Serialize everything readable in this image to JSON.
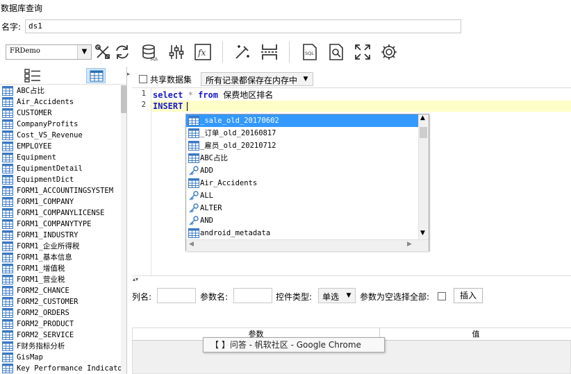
{
  "window": {
    "title": "数据库查询"
  },
  "name_row": {
    "label": "名字:",
    "value": "ds1"
  },
  "toolbar": {
    "datasource": "FRDemo",
    "icons": [
      "tools-icon",
      "refresh-icon",
      "sql-database-icon",
      "sliders-icon",
      "formula-fx-icon",
      "magic-wand-icon",
      "page-break-icon",
      "sql-file-icon",
      "preview-icon",
      "fullscreen-icon",
      "settings-gear-icon"
    ]
  },
  "left_panel": {
    "tabs": [
      "list-view",
      "table-view"
    ],
    "tables": [
      "ABC占比",
      "Air_Accidents",
      "CUSTOMER",
      "CompanyProfits",
      "Cost_VS_Revenue",
      "EMPLOYEE",
      "Equipment",
      "EquipmentDetail",
      "EquipmentDict",
      "FORM1_ACCOUNTINGSYSTEM",
      "FORM1_COMPANY",
      "FORM1_COMPANYLICENSE",
      "FORM1_COMPANYTYPE",
      "FORM1_INDUSTRY",
      "FORM1_企业所得税",
      "FORM1_基本信息",
      "FORM1_增值税",
      "FORM1_营业税",
      "FORM2_CHANCE",
      "FORM2_CUSTOMER",
      "FORM2_ORDERS",
      "FORM2_PRODUCT",
      "FORM2_SERVICE",
      "F财务指标分析",
      "GisMap",
      "Key Performance Indicators"
    ]
  },
  "sql_options": {
    "share_label": "共享数据集",
    "cache_option": "所有记录都保存在内存中"
  },
  "editor": {
    "line_numbers": [
      "1",
      "2"
    ],
    "line1": {
      "kw1": "select",
      "op": "*",
      "kw2": "from",
      "rest": "保费地区排名"
    },
    "line2": {
      "kw": "INSERT"
    }
  },
  "autocomplete": {
    "items": [
      {
        "label": "_sale_old_20170602",
        "icon": "table-icon",
        "selected": true
      },
      {
        "label": "_订单_old_20160817",
        "icon": "table-icon"
      },
      {
        "label": "_雇员_old_20210712",
        "icon": "table-icon"
      },
      {
        "label": "ABC占比",
        "icon": "table-icon"
      },
      {
        "label": "ADD",
        "icon": "key-icon"
      },
      {
        "label": "Air_Accidents",
        "icon": "table-icon"
      },
      {
        "label": "ALL",
        "icon": "key-icon"
      },
      {
        "label": "ALTER",
        "icon": "key-icon"
      },
      {
        "label": "AND",
        "icon": "key-icon"
      },
      {
        "label": "android_metadata",
        "icon": "table-icon"
      }
    ]
  },
  "param_bar": {
    "col_label": "列名:",
    "param_label": "参数名:",
    "ctrl_type_label": "控件类型:",
    "ctrl_type_value": "单选",
    "empty_all_label": "参数为空选择全部:",
    "insert_button": "插入"
  },
  "param_table": {
    "col_param": "参数",
    "col_value": "值"
  },
  "tooltip": {
    "text": "【         】问答 - 帆软社区 - Google Chrome"
  },
  "colors": {
    "keyword": "#1818c8",
    "selection": "#3399ff",
    "line_highlight": "#fefec8",
    "table_icon": "#3b78c4"
  }
}
